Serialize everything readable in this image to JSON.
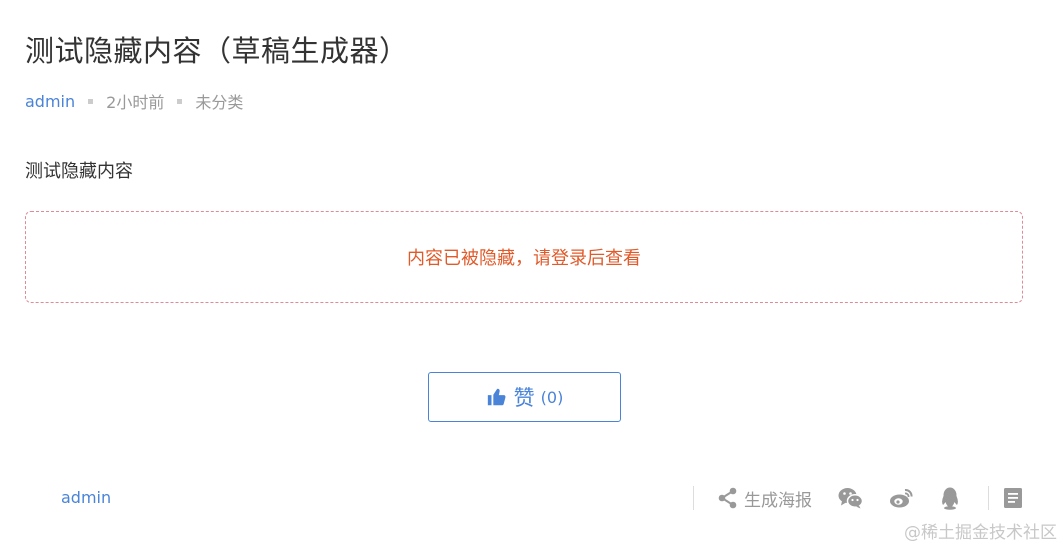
{
  "post": {
    "title": "测试隐藏内容（草稿生成器）",
    "author": "admin",
    "time": "2小时前",
    "category": "未分类",
    "content": "测试隐藏内容",
    "hidden_message": "内容已被隐藏，请登录后查看"
  },
  "like": {
    "label": "赞",
    "count": "(0)"
  },
  "footer": {
    "author": "admin",
    "poster_label": "生成海报"
  },
  "watermark": "@稀土掘金技术社区",
  "colors": {
    "accent": "#4a84d8",
    "hidden_text": "#e05a2a",
    "hidden_border": "#e08a95",
    "muted": "#999999"
  },
  "icons": [
    "thumbs-up-icon",
    "share-icon",
    "wechat-icon",
    "weibo-icon",
    "qq-icon",
    "document-icon"
  ]
}
